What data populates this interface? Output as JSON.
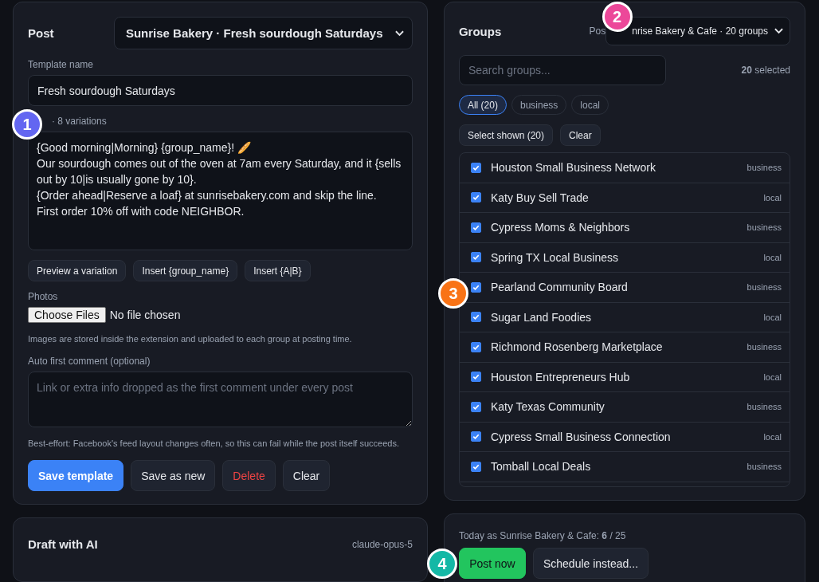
{
  "post": {
    "title": "Post",
    "template_select": "Sunrise Bakery · Fresh sourdough Saturdays",
    "template_name_label": "Template name",
    "template_name": "Fresh sourdough Saturdays",
    "text_label": "· 8 variations",
    "text_lines": [
      "{Good morning|Morning} {group_name}! 🥖",
      "Our sourdough comes out of the oven at 7am every Saturday, and it {sells out by 10|is usually gone by 10}.",
      "{Order ahead|Reserve a loaf} at sunrisebakery.com and skip the line.",
      "First order 10% off with code NEIGHBOR."
    ],
    "tools": [
      "Preview a variation",
      "Insert {group_name}",
      "Insert {A|B}"
    ],
    "photos_label": "Photos",
    "choose_files": "Choose Files",
    "no_file": "No file chosen",
    "photos_hint": "Images are stored inside the extension and uploaded to each group at posting time.",
    "comment_label": "Auto first comment (optional)",
    "comment_placeholder": "Link or extra info dropped as the first comment under every post",
    "comment_hint": "Best-effort: Facebook's feed layout changes often, so this can fail while the post itself succeeds.",
    "actions": [
      {
        "label": "Save template",
        "kind": "primary"
      },
      {
        "label": "Save as new",
        "kind": "plain"
      },
      {
        "label": "Delete",
        "kind": "danger"
      },
      {
        "label": "Clear",
        "kind": "plain"
      }
    ]
  },
  "draft": {
    "title": "Draft with AI",
    "model": "claude-opus-5"
  },
  "groups": {
    "title": "Groups",
    "posting_label": "Pos",
    "account_select": "nrise Bakery & Cafe · 20 groups",
    "search_placeholder": "Search groups...",
    "selected_count": "20",
    "selected_label": "selected",
    "filters": [
      {
        "label": "All (20)",
        "selected": true
      },
      {
        "label": "business",
        "selected": false
      },
      {
        "label": "local",
        "selected": false
      }
    ],
    "bulk": [
      "Select shown (20)",
      "Clear"
    ],
    "items": [
      {
        "name": "Houston Small Business Network",
        "tag": "business",
        "checked": true
      },
      {
        "name": "Katy Buy Sell Trade",
        "tag": "local",
        "checked": true
      },
      {
        "name": "Cypress Moms & Neighbors",
        "tag": "business",
        "checked": true
      },
      {
        "name": "Spring TX Local Business",
        "tag": "local",
        "checked": true
      },
      {
        "name": "Pearland Community Board",
        "tag": "business",
        "checked": true
      },
      {
        "name": "Sugar Land Foodies",
        "tag": "local",
        "checked": true
      },
      {
        "name": "Richmond Rosenberg Marketplace",
        "tag": "business",
        "checked": true
      },
      {
        "name": "Houston Entrepreneurs Hub",
        "tag": "local",
        "checked": true
      },
      {
        "name": "Katy Texas Community",
        "tag": "business",
        "checked": true
      },
      {
        "name": "Cypress Small Business Connection",
        "tag": "local",
        "checked": true
      },
      {
        "name": "Tomball Local Deals",
        "tag": "business",
        "checked": true
      }
    ]
  },
  "send": {
    "today_label": "Today as Sunrise Bakery & Cafe: **6** / 25",
    "post_now": "Post now",
    "schedule": "Schedule instead..."
  },
  "markers": [
    {
      "label": "1",
      "color": "#6366f1"
    },
    {
      "label": "2",
      "color": "#ec4899"
    },
    {
      "label": "3",
      "color": "#f97316"
    },
    {
      "label": "4",
      "color": "#14b8a6"
    }
  ]
}
